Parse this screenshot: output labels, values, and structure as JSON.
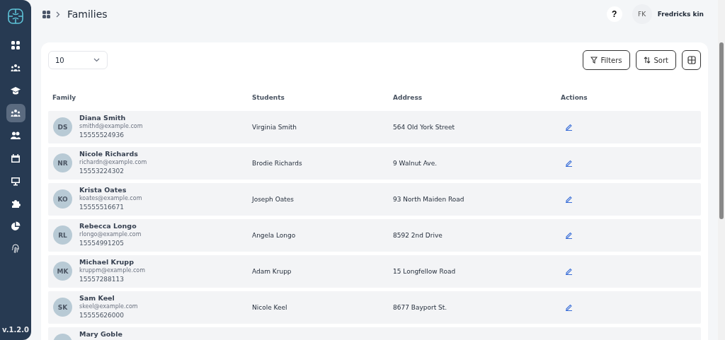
{
  "sidebar": {
    "items": [
      {
        "kind": "dashboard",
        "selected": false
      },
      {
        "kind": "group",
        "selected": false
      },
      {
        "kind": "graduation",
        "selected": false
      },
      {
        "kind": "families",
        "selected": true
      },
      {
        "kind": "users",
        "selected": false
      },
      {
        "kind": "calendar",
        "selected": false
      },
      {
        "kind": "monitor",
        "selected": false
      },
      {
        "kind": "puzzle",
        "selected": false
      },
      {
        "kind": "pie",
        "selected": false
      },
      {
        "kind": "fingerprint",
        "selected": false
      }
    ],
    "version": "v.1.2.0"
  },
  "header": {
    "title": "Families",
    "help": "?",
    "user": {
      "initials": "FK",
      "name": "Fredricks kin"
    }
  },
  "toolbar": {
    "page_size": "10",
    "buttons": [
      "Filters",
      "Sort"
    ]
  },
  "table": {
    "columns": [
      "Family",
      "Students",
      "Address",
      "Actions"
    ],
    "rows": [
      {
        "initials": "DS",
        "name": "Diana Smith",
        "email": "smithd@example.com",
        "phone": "15555524936",
        "students": "Virginia Smith",
        "address": "564 Old York Street"
      },
      {
        "initials": "NR",
        "name": "Nicole Richards",
        "email": "richardn@example.com",
        "phone": "15553224302",
        "students": "Brodie Richards",
        "address": "9 Walnut Ave."
      },
      {
        "initials": "KO",
        "name": "Krista Oates",
        "email": "koates@example.com",
        "phone": "15555516671",
        "students": "Joseph Oates",
        "address": "93 North Maiden Road"
      },
      {
        "initials": "RL",
        "name": "Rebecca Longo",
        "email": "rlongo@example.com",
        "phone": "15554991205",
        "students": "Angela Longo",
        "address": "8592 2nd Drive"
      },
      {
        "initials": "MK",
        "name": "Michael Krupp",
        "email": "kruppm@example.com",
        "phone": "15557288113",
        "students": "Adam Krupp",
        "address": "15 Longfellow Road"
      },
      {
        "initials": "SK",
        "name": "Sam Keel",
        "email": "skeel@example.com",
        "phone": "15555626000",
        "students": "Nicole Keel",
        "address": "8677 Bayport St."
      },
      {
        "name": "Mary Goble"
      }
    ]
  }
}
